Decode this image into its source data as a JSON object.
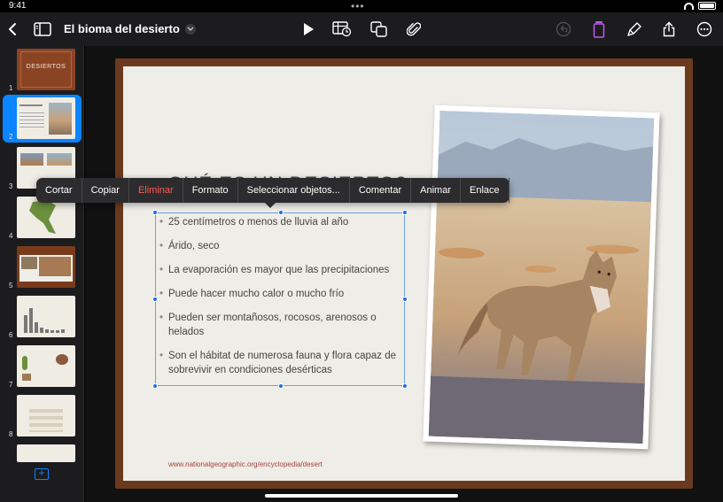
{
  "status": {
    "time": "9:41"
  },
  "toolbar": {
    "title": "El bioma del desierto",
    "icons": [
      "back-chevron-icon",
      "sidebar-toggle-icon",
      "chevron-down-icon",
      "play-icon",
      "table-icon",
      "shapes-icon",
      "paperclip-icon",
      "undo-icon",
      "format-icon",
      "brush-icon",
      "share-icon",
      "more-icon"
    ],
    "accent": "#bf5af2"
  },
  "sidebar": {
    "slides": [
      {
        "number": "1",
        "label": "DESIERTOS"
      },
      {
        "number": "2",
        "label": ""
      },
      {
        "number": "3",
        "label": ""
      },
      {
        "number": "4",
        "label": ""
      },
      {
        "number": "5",
        "label": ""
      },
      {
        "number": "6",
        "label": ""
      },
      {
        "number": "7",
        "label": ""
      },
      {
        "number": "8",
        "label": ""
      }
    ],
    "selected": "2",
    "selection_color": "#0a84ff"
  },
  "context_menu": {
    "items": [
      "Cortar",
      "Copiar",
      "Eliminar",
      "Formato",
      "Seleccionar objetos...",
      "Comentar",
      "Animar",
      "Enlace"
    ],
    "destructive_color": "#ff5a4f"
  },
  "slide": {
    "heading": "¿QUÉ ES UN DESIERTO?",
    "bullets": [
      "25 centímetros o menos de lluvia al año",
      "Árido, seco",
      "La evaporación es mayor que las precipitaciones",
      "Puede hacer mucho calor o mucho frío",
      "Pueden ser montañosos, rocosos, arenosos o helados",
      "Son el hábitat de numerosa fauna y flora capaz de sobrevivir en condiciones desérticas"
    ],
    "source": "www.nationalgeographic.org/encyclopedia/desert",
    "frame_color": "#6b3a1e"
  }
}
